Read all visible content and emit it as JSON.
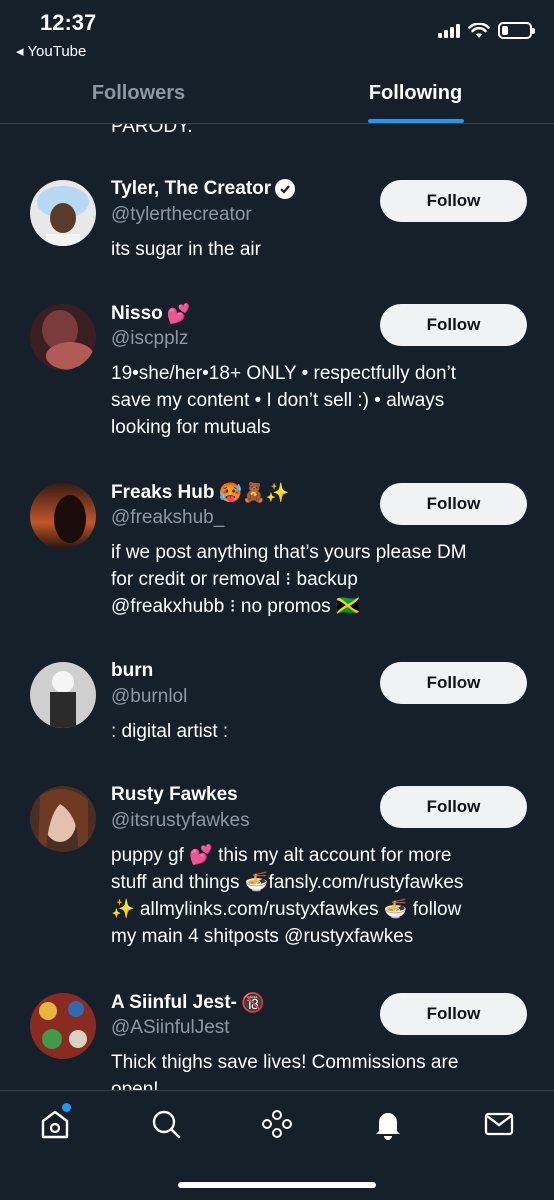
{
  "status_bar": {
    "time": "12:37",
    "back_app": "◂ YouTube",
    "battery_level": 0.22
  },
  "tabs": [
    {
      "label": "Followers",
      "active": false
    },
    {
      "label": "Following",
      "active": true
    }
  ],
  "feed": {
    "cut_text": "PARODY.",
    "users": [
      {
        "name": "Tyler, The Creator",
        "name_emoji": "",
        "verified": true,
        "handle": "@tylerthecreator",
        "bio": [
          "its sugar in the air"
        ],
        "button": "Follow"
      },
      {
        "name": "Nisso",
        "name_emoji": "💕",
        "verified": false,
        "handle": "@iscpplz",
        "bio": [
          "19•she/her•18+ ONLY • respectfully don’t",
          "save my content • I don’t sell :) • always",
          "looking for mutuals"
        ],
        "button": "Follow"
      },
      {
        "name": "Freaks Hub",
        "name_emoji": "🥵🧸✨",
        "verified": false,
        "handle": "@freakshub_",
        "bio": [
          "if we post anything that’s yours please DM",
          "for credit or removal ⁝ backup",
          "@freakxhubb ⁝ no promos 🇯🇲"
        ],
        "button": "Follow"
      },
      {
        "name": "burn",
        "name_emoji": "",
        "verified": false,
        "handle": "@burnlol",
        "bio": [
          ": digital artist :"
        ],
        "button": "Follow"
      },
      {
        "name": "Rusty Fawkes",
        "name_emoji": "",
        "verified": false,
        "handle": "@itsrustyfawkes",
        "bio": [
          "puppy gf 💕  this my alt account for more",
          "stuff and things 🍜fansly.com/rustyfawkes",
          "✨ allmylinks.com/rustyxfawkes 🍜 follow",
          "my main 4 shitposts @rustyxfawkes"
        ],
        "button": "Follow"
      },
      {
        "name": "A Siinful Jest-",
        "name_emoji": "🔞",
        "verified": false,
        "handle": "@ASiinfulJest",
        "bio": [
          "Thick thighs save lives! Commissions are",
          "open!"
        ],
        "button": "Follow"
      }
    ]
  },
  "bottom_nav": [
    {
      "icon": "home-icon",
      "has_badge": true
    },
    {
      "icon": "search-icon"
    },
    {
      "icon": "spaces-icon"
    },
    {
      "icon": "bell-icon",
      "active": true
    },
    {
      "icon": "mail-icon"
    }
  ],
  "colors": {
    "background": "#15202b",
    "accent": "#1d9bf0",
    "muted": "#8b98a5",
    "button_bg": "#eff3f4"
  }
}
